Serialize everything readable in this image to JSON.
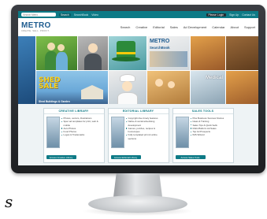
{
  "utility_bar": {
    "search_placeholder": "Search Metro...",
    "search_button": "Search",
    "links": [
      "SearchBook",
      "Video"
    ],
    "login_label": "Please Login",
    "signup_label": "Sign Up",
    "contact_label": "Contact Us"
  },
  "header": {
    "logo": "METRO",
    "tagline": "CREATE. SELL. PROFIT."
  },
  "nav": {
    "items": [
      "Search",
      "Creative",
      "Editorial",
      "Sales",
      "Ad Development",
      "Calendar",
      "About",
      "Support"
    ]
  },
  "hero": {
    "shed_title": "SHED",
    "shed_title2": "SALE",
    "shed_caption": "Shed Buildings & Garden",
    "searchbook_title": "METRO",
    "searchbook_sub": "SearchBook",
    "medical_title": "Medical"
  },
  "libraries": [
    {
      "title": "CREATIVE LIBRARY",
      "items": [
        "Photos, vectors, illustrations",
        "Spec ad templates for print, web & mobile",
        "Auto Photos",
        "Food Photos",
        "Logos & Trademarks"
      ],
      "button": "Access Creative Library"
    },
    {
      "title": "EDITORIAL LIBRARY",
      "items": [
        "Copyright-free timely features",
        "Native & social advertising development",
        "Games, puzzles, recipes & horoscopes",
        "Fully templated print & online sections"
      ],
      "button": "Access Editorial Library"
    },
    {
      "title": "SALES TOOLS",
      "items": [
        "Plus Business Success Stories",
        "Ideas & Training",
        "Sales Tips & Quick Sells",
        "Multi-Platform Ad Sales",
        "Top Ad Prospects",
        "IMS Wizard"
      ],
      "button": "Access Sales Tools"
    }
  ],
  "decor": {
    "stray_glyph": "s"
  },
  "colors": {
    "brand_teal": "#0d7a86",
    "logo_blue": "#1d5b8f",
    "accent_yellow": "#f7d21e"
  }
}
